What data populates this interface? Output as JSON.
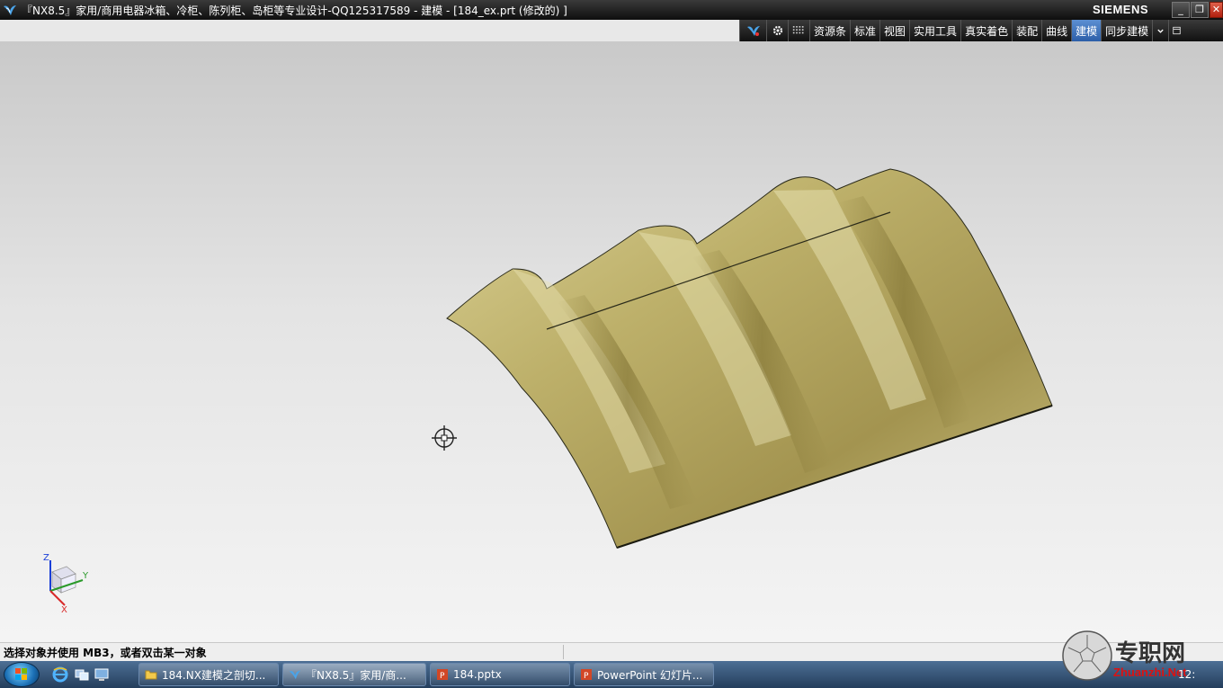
{
  "window": {
    "title": "『NX8.5』家用/商用电器冰箱、冷柜、陈列柜、岛柜等专业设计-QQ125317589 - 建模 - [184_ex.prt  (修改的) ]",
    "brand": "SIEMENS",
    "minimize": "_",
    "restore": "❐",
    "close": "✕"
  },
  "toolbar": {
    "items": [
      "资源条",
      "标准",
      "视图",
      "实用工具",
      "真实着色",
      "装配",
      "曲线",
      "建模",
      "同步建模"
    ],
    "active": "建模"
  },
  "viewport": {
    "model_color": "#c9bd7a",
    "triad": {
      "z": "Z",
      "y": "Y",
      "x": "X"
    }
  },
  "status": {
    "prompt": "选择对象并使用 MB3，或者双击某一对象"
  },
  "taskbar": {
    "tasks": [
      {
        "label": "184.NX建模之剖切..."
      },
      {
        "label": "『NX8.5』家用/商..."
      },
      {
        "label": "184.pptx"
      },
      {
        "label": "PowerPoint 幻灯片..."
      }
    ],
    "clock": "12:"
  },
  "watermark": {
    "text": "专职网",
    "url": "Zhuanzhi.Net"
  }
}
